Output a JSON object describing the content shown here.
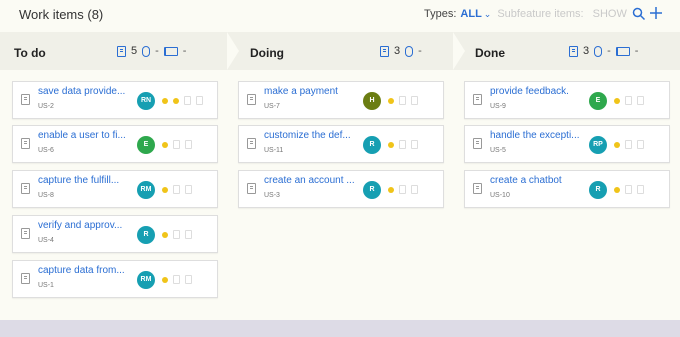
{
  "header": {
    "title": "Work items (8)",
    "types_label": "Types:",
    "types_value": "ALL",
    "subfeature_label": "Subfeature items:",
    "subfeature_value": "SHOW",
    "search_icon": "search-icon",
    "add_icon": "plus-icon"
  },
  "colors": {
    "accent": "#2b6ed3",
    "yellow": "#f0c419",
    "teal": "#169fb2",
    "green": "#2ea84d",
    "olive": "#6b7d12"
  },
  "lanes": [
    {
      "title": "To do",
      "count": "5",
      "bug_value": "-",
      "flag_value": "-",
      "cards": [
        {
          "title": "save data provide...",
          "id": "US-2",
          "avatar": "RN",
          "avatar_color": "#169fb2",
          "dots": [
            "#f0c419",
            "#f0c419"
          ]
        },
        {
          "title": "enable a user to fi...",
          "id": "US-6",
          "avatar": "E",
          "avatar_color": "#2ea84d",
          "dots": [
            "#f0c419"
          ]
        },
        {
          "title": "capture the fulfill...",
          "id": "US-8",
          "avatar": "RM",
          "avatar_color": "#169fb2",
          "dots": [
            "#f0c419"
          ]
        },
        {
          "title": "verify and approv...",
          "id": "US-4",
          "avatar": "R",
          "avatar_color": "#169fb2",
          "dots": [
            "#f0c419"
          ]
        },
        {
          "title": "capture data from...",
          "id": "US-1",
          "avatar": "RM",
          "avatar_color": "#169fb2",
          "dots": [
            "#f0c419"
          ]
        }
      ]
    },
    {
      "title": "Doing",
      "count": "3",
      "bug_value": "-",
      "flag_value": "",
      "cards": [
        {
          "title": "make a payment",
          "id": "US-7",
          "avatar": "H",
          "avatar_color": "#6b7d12",
          "dots": [
            "#f0c419"
          ]
        },
        {
          "title": "customize the def...",
          "id": "US-11",
          "avatar": "R",
          "avatar_color": "#169fb2",
          "dots": [
            "#f0c419"
          ]
        },
        {
          "title": "create an account ...",
          "id": "US-3",
          "avatar": "R",
          "avatar_color": "#169fb2",
          "dots": [
            "#f0c419"
          ]
        }
      ]
    },
    {
      "title": "Done",
      "count": "3",
      "bug_value": "-",
      "flag_value": "-",
      "cards": [
        {
          "title": "provide feedback.",
          "id": "US-9",
          "avatar": "E",
          "avatar_color": "#2ea84d",
          "dots": [
            "#f0c419"
          ]
        },
        {
          "title": "handle the excepti...",
          "id": "US-5",
          "avatar": "RP",
          "avatar_color": "#169fb2",
          "dots": [
            "#f0c419"
          ]
        },
        {
          "title": "create a chatbot",
          "id": "US-10",
          "avatar": "R",
          "avatar_color": "#169fb2",
          "dots": [
            "#f0c419"
          ]
        }
      ]
    }
  ]
}
